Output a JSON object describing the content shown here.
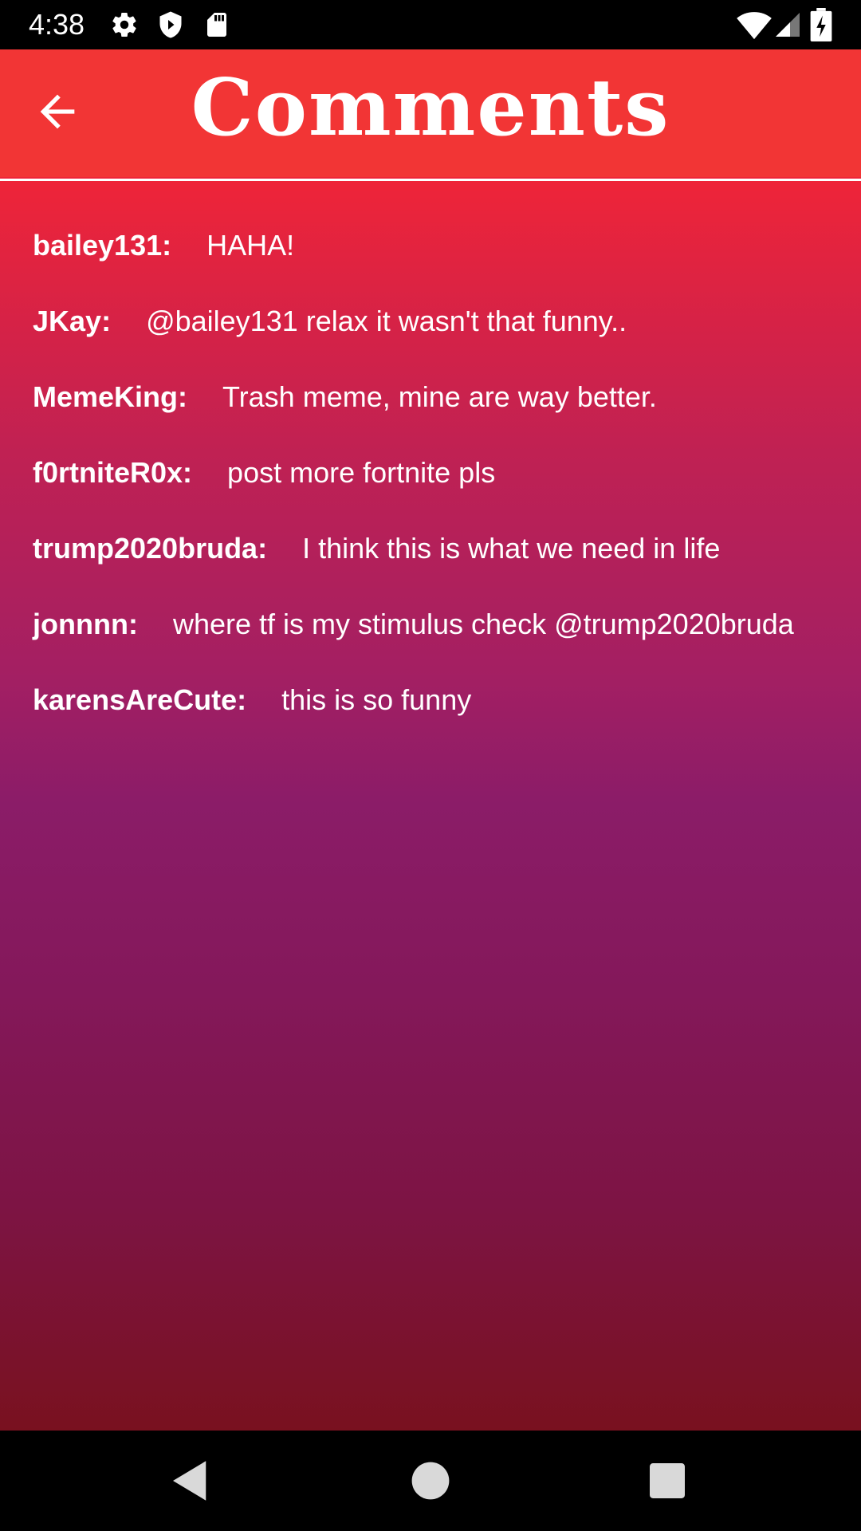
{
  "status_bar": {
    "time": "4:38",
    "icons_left": [
      "gear-icon",
      "shield-icon",
      "sd-card-icon"
    ],
    "icons_right": [
      "wifi-icon",
      "signal-icon",
      "battery-charging-icon"
    ]
  },
  "app_bar": {
    "title": "Comments",
    "back_icon": "arrow-back-icon",
    "background_color": "#f23535"
  },
  "comments": [
    {
      "user": "bailey131:",
      "text": "HAHA!"
    },
    {
      "user": "JKay:",
      "text": "@bailey131 relax it wasn't that funny.."
    },
    {
      "user": "MemeKing:",
      "text": "Trash meme, mine are way better."
    },
    {
      "user": "f0rtniteR0x:",
      "text": "post more fortnite pls"
    },
    {
      "user": "trump2020bruda:",
      "text": "I think this is what we need in life"
    },
    {
      "user": "jonnnn:",
      "text": "where tf is my stimulus check @trump2020bruda"
    },
    {
      "user": "karensAreCute:",
      "text": "this is so funny"
    }
  ],
  "nav_bar": {
    "buttons": [
      "back-triangle-icon",
      "home-circle-icon",
      "recents-square-icon"
    ]
  },
  "colors": {
    "gradient_top": "#ef2438",
    "gradient_middle": "#8b1c68",
    "gradient_bottom": "#79111f",
    "text": "#ffffff"
  }
}
